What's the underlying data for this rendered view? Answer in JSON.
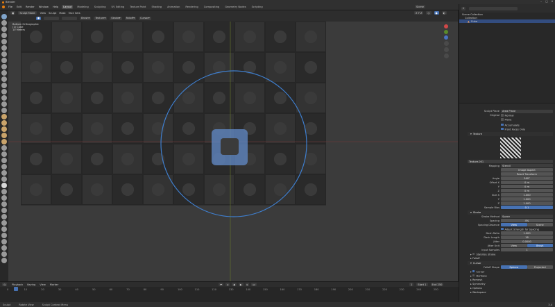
{
  "app": {
    "title": "Blender"
  },
  "menus": [
    "File",
    "Edit",
    "Render",
    "Window",
    "Help"
  ],
  "workspaces": [
    "Layout",
    "Modeling",
    "Sculpting",
    "UV Editing",
    "Texture Paint",
    "Shading",
    "Animation",
    "Rendering",
    "Compositing",
    "Geometry Nodes",
    "Scripting"
  ],
  "active_workspace": "Layout",
  "topright": {
    "scene": "Scene",
    "view_layer": "ViewLayer"
  },
  "viewport_header": {
    "mode": "Sculpt Mode",
    "menus": [
      "View",
      "Sculpt",
      "Mask",
      "Face Sets"
    ],
    "brush": "Brush",
    "texture": "Texture",
    "stroke": "Stroke",
    "falloff": "Falloff",
    "cursor": "Cursor",
    "symmetry": "X Y Z",
    "overlay_info": [
      "Bottom Orthographic",
      "(1) Cube",
      "10 Meters"
    ]
  },
  "outliner": {
    "title": "Scene Collection",
    "items": [
      "Collection",
      "Cube"
    ]
  },
  "properties": {
    "sculpt_plane_label": "Sculpt Plane",
    "sculpt_plane_value": "Area Plane",
    "original_label": "Original",
    "normal": "Normal",
    "plane": "Plane",
    "accumulate": "Accumulate",
    "front_faces": "Front Faces Only",
    "texture_panel": "Texture",
    "texture_name": "Texture.001",
    "mapping_label": "Mapping",
    "mapping_value": "Stencil",
    "image_aspect": "Image Aspect",
    "reset_transform": "Reset Transform",
    "angle_label": "Angle",
    "angle_value": "360°",
    "offset_label": "Offset X",
    "offset": [
      "0 m",
      "0 m",
      "0 m"
    ],
    "size_label": "Size X",
    "size": [
      "1.000",
      "1.000",
      "1.000"
    ],
    "sample_bias_label": "Sample Bias",
    "sample_bias_value": "0.1",
    "stroke_panel": "Stroke",
    "stroke_method_label": "Stroke Method",
    "stroke_method_value": "Space",
    "spacing_label": "Spacing",
    "spacing_value": "4%",
    "spacing_distance_label": "Spacing Distance",
    "spacing_distance_opts": [
      "View",
      "Scene"
    ],
    "adjust_strength": "Adjust Strength for Spacing",
    "dash_ratio_label": "Dash Ratio",
    "dash_ratio_value": "1.000",
    "dash_length_label": "Dash Length",
    "dash_length_value": "18",
    "jitter_label": "Jitter",
    "jitter_value": "0.0000",
    "jitter_unit_label": "Jitter Unit",
    "jitter_unit_opts": [
      "View",
      "Brush"
    ],
    "input_samples_label": "Input Samples",
    "input_samples_value": "1",
    "stabilize": "Stabilize Stroke",
    "falloff_panel": "Falloff",
    "cursor_panel": "Cursor",
    "falloff_shape_label": "Falloff Shape",
    "falloff_shape_opts": [
      "Sphere",
      "Projected"
    ],
    "cursor_chk": "Cursor",
    "dyntopo": "Dyntopo",
    "remesh": "Remesh",
    "symmetry": "Symmetry",
    "options": "Options",
    "workspace": "Workspace"
  },
  "timeline": {
    "menus": [
      "Playback",
      "Keying",
      "View",
      "Marker"
    ],
    "start_label": "Start",
    "start": "1",
    "end_label": "End",
    "end": "250",
    "current_frame": "1",
    "ticks": [
      "0",
      "10",
      "20",
      "30",
      "40",
      "50",
      "60",
      "70",
      "80",
      "90",
      "100",
      "110",
      "120",
      "130",
      "140",
      "150",
      "160",
      "170",
      "180",
      "190",
      "200",
      "210",
      "220",
      "230",
      "240",
      "250"
    ]
  },
  "statusbar": [
    "Sculpt",
    "Rotate View",
    "Sculpt Context Menu"
  ],
  "version": "3.4"
}
